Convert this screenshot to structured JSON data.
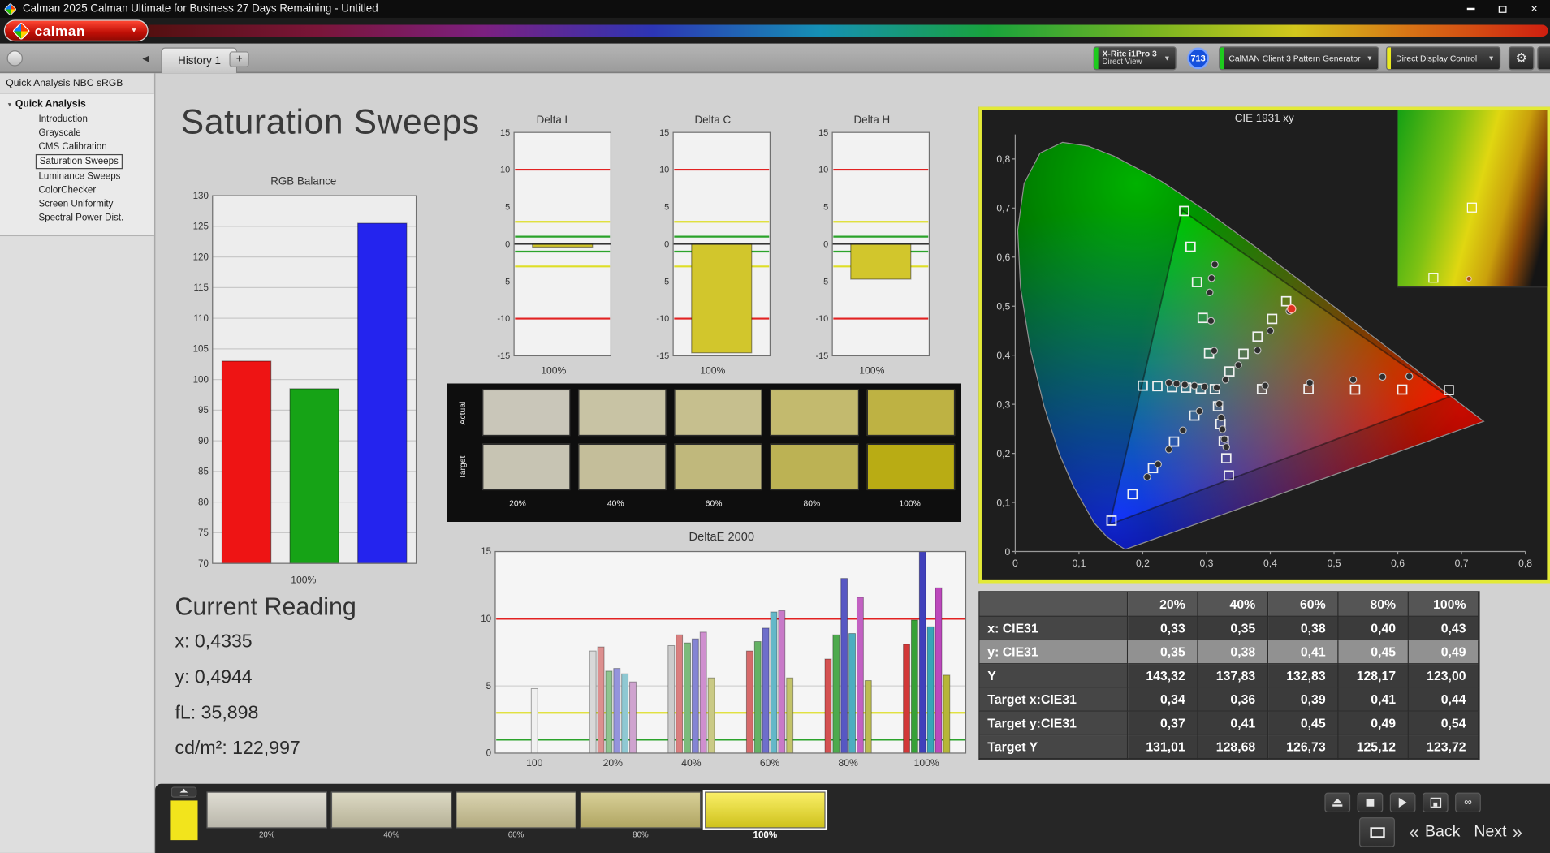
{
  "window": {
    "title": "Calman 2025 Calman Ultimate for Business 27 Days Remaining  - Untitled"
  },
  "brand": {
    "logo_text": "calman"
  },
  "tab_bar": {
    "tabs": [
      {
        "label": "History 1"
      }
    ],
    "add_tab_label": "+",
    "meter": {
      "line1": "X-Rite i1Pro 3",
      "line2": "Direct View",
      "accent": "#1ecb1e"
    },
    "meter_badge": "713",
    "source": {
      "label": "CalMAN Client 3 Pattern Generator",
      "accent": "#1ecb1e"
    },
    "display_control": {
      "label": "Direct Display Control",
      "accent": "#e9e920"
    }
  },
  "sidebar": {
    "header": "Quick Analysis NBC sRGB",
    "root_label": "Quick Analysis",
    "items": [
      {
        "label": "Introduction",
        "selected": false
      },
      {
        "label": "Grayscale",
        "selected": false
      },
      {
        "label": "CMS Calibration",
        "selected": false
      },
      {
        "label": "Saturation Sweeps",
        "selected": true
      },
      {
        "label": "Luminance Sweeps",
        "selected": false
      },
      {
        "label": "ColorChecker",
        "selected": false
      },
      {
        "label": "Screen Uniformity",
        "selected": false
      },
      {
        "label": "Spectral Power Dist.",
        "selected": false
      }
    ]
  },
  "page_title": "Saturation Sweeps",
  "current_reading": {
    "title": "Current Reading",
    "lines": [
      "x: 0,4335",
      "y: 0,4944",
      "fL: 35,898",
      "cd/m²: 122,997"
    ]
  },
  "sat_swatches": {
    "row_labels": [
      "Actual",
      "Target"
    ],
    "column_labels": [
      "20%",
      "40%",
      "60%",
      "80%",
      "100%"
    ],
    "actual_colors": [
      "#c9c6b9",
      "#c8c3a4",
      "#c6bf8e",
      "#c3ba6e",
      "#beb243"
    ],
    "target_colors": [
      "#c7c4b3",
      "#c4be9a",
      "#c0b87c",
      "#bcb254",
      "#b9ac14"
    ]
  },
  "results_table": {
    "columns": [
      "20%",
      "40%",
      "60%",
      "80%",
      "100%"
    ],
    "rows": [
      {
        "label": "x: CIE31",
        "values": [
          "0,33",
          "0,35",
          "0,38",
          "0,40",
          "0,43"
        ],
        "highlight": false
      },
      {
        "label": "y: CIE31",
        "values": [
          "0,35",
          "0,38",
          "0,41",
          "0,45",
          "0,49"
        ],
        "highlight": true
      },
      {
        "label": "Y",
        "values": [
          "143,32",
          "137,83",
          "132,83",
          "128,17",
          "123,00"
        ],
        "highlight": false
      },
      {
        "label": "Target x:CIE31",
        "values": [
          "0,34",
          "0,36",
          "0,39",
          "0,41",
          "0,44"
        ],
        "highlight": false
      },
      {
        "label": "Target y:CIE31",
        "values": [
          "0,37",
          "0,41",
          "0,45",
          "0,49",
          "0,54"
        ],
        "highlight": false
      },
      {
        "label": "Target Y",
        "values": [
          "131,01",
          "128,68",
          "126,73",
          "125,12",
          "123,72"
        ],
        "highlight": false
      }
    ]
  },
  "bottom_bar": {
    "swatches": [
      {
        "label": "20%",
        "color": "#d3d0c2",
        "selected": false
      },
      {
        "label": "40%",
        "color": "#cfcaac",
        "selected": false
      },
      {
        "label": "60%",
        "color": "#ccc392",
        "selected": false
      },
      {
        "label": "80%",
        "color": "#c9bd70",
        "selected": false
      },
      {
        "label": "100%",
        "color": "#d2c51d",
        "selected": true
      }
    ],
    "back_label": "Back",
    "next_label": "Next"
  },
  "chart_data": [
    {
      "id": "rgb_balance",
      "type": "bar",
      "title": "RGB Balance",
      "xlabel": "100%",
      "categories": [
        "Red",
        "Green",
        "Blue"
      ],
      "values": [
        103.0,
        98.5,
        125.5
      ],
      "colors": [
        "#ee1414",
        "#16a316",
        "#2424ee"
      ],
      "ylim": [
        70,
        130
      ],
      "ytick_step": 5,
      "grid": true
    },
    {
      "id": "delta_l",
      "type": "bar",
      "title": "Delta L",
      "xlabel": "100%",
      "categories": [
        "100%"
      ],
      "values": [
        -0.4
      ],
      "colors": [
        "#d2c62c"
      ],
      "ylim": [
        -15,
        15
      ],
      "ytick_step": 5,
      "grid": false,
      "ref_lines": [
        {
          "y": 10,
          "color": "#e22222"
        },
        {
          "y": -10,
          "color": "#e22222"
        },
        {
          "y": 3,
          "color": "#dede26"
        },
        {
          "y": -3,
          "color": "#dede26"
        },
        {
          "y": 1,
          "color": "#2ba32b"
        },
        {
          "y": -1,
          "color": "#2ba32b"
        }
      ]
    },
    {
      "id": "delta_c",
      "type": "bar",
      "title": "Delta C",
      "xlabel": "100%",
      "categories": [
        "100%"
      ],
      "values": [
        -14.6
      ],
      "colors": [
        "#d2c62c"
      ],
      "ylim": [
        -15,
        15
      ],
      "ytick_step": 5,
      "grid": false,
      "ref_lines": [
        {
          "y": 10,
          "color": "#e22222"
        },
        {
          "y": -10,
          "color": "#e22222"
        },
        {
          "y": 3,
          "color": "#dede26"
        },
        {
          "y": -3,
          "color": "#dede26"
        },
        {
          "y": 1,
          "color": "#2ba32b"
        },
        {
          "y": -1,
          "color": "#2ba32b"
        }
      ]
    },
    {
      "id": "delta_h",
      "type": "bar",
      "title": "Delta H",
      "xlabel": "100%",
      "categories": [
        "100%"
      ],
      "values": [
        -4.7
      ],
      "colors": [
        "#d2c62c"
      ],
      "ylim": [
        -15,
        15
      ],
      "ytick_step": 5,
      "grid": false,
      "ref_lines": [
        {
          "y": 10,
          "color": "#e22222"
        },
        {
          "y": -10,
          "color": "#e22222"
        },
        {
          "y": 3,
          "color": "#dede26"
        },
        {
          "y": -3,
          "color": "#dede26"
        },
        {
          "y": 1,
          "color": "#2ba32b"
        },
        {
          "y": -1,
          "color": "#2ba32b"
        }
      ]
    },
    {
      "id": "deltae2000",
      "type": "grouped_bar",
      "title": "DeltaE 2000",
      "ylim": [
        0,
        15
      ],
      "yticks": [
        0,
        5,
        10,
        15
      ],
      "ref_lines": [
        {
          "y": 10,
          "color": "#e22222"
        },
        {
          "y": 3,
          "color": "#dede26"
        },
        {
          "y": 1,
          "color": "#2ba32b"
        }
      ],
      "groups": [
        {
          "label": "100",
          "bars": [
            {
              "color": "#f0f0f0",
              "value": 4.8
            }
          ]
        },
        {
          "label": "20%",
          "bars": [
            {
              "color": "#d8d8d8",
              "value": 7.6
            },
            {
              "color": "#dc8f8f",
              "value": 7.9
            },
            {
              "color": "#8fc48f",
              "value": 6.1
            },
            {
              "color": "#9494dc",
              "value": 6.3
            },
            {
              "color": "#8fc8d2",
              "value": 5.9
            },
            {
              "color": "#cfa3cf",
              "value": 5.3
            }
          ]
        },
        {
          "label": "40%",
          "bars": [
            {
              "color": "#cccccc",
              "value": 8.0
            },
            {
              "color": "#d97f7f",
              "value": 8.8
            },
            {
              "color": "#7bbb7b",
              "value": 8.2
            },
            {
              "color": "#8484d4",
              "value": 8.5
            },
            {
              "color": "#cf8fcf",
              "value": 9.0
            },
            {
              "color": "#caca85",
              "value": 5.6
            }
          ]
        },
        {
          "label": "60%",
          "bars": [
            {
              "color": "#d66a6a",
              "value": 7.6
            },
            {
              "color": "#64b264",
              "value": 8.3
            },
            {
              "color": "#6e6ecb",
              "value": 9.3
            },
            {
              "color": "#64b8c8",
              "value": 10.5
            },
            {
              "color": "#c879c8",
              "value": 10.6
            },
            {
              "color": "#c3c36a",
              "value": 5.6
            }
          ]
        },
        {
          "label": "80%",
          "bars": [
            {
              "color": "#d45151",
              "value": 7.0
            },
            {
              "color": "#4daa4d",
              "value": 8.8
            },
            {
              "color": "#5757c3",
              "value": 13.0
            },
            {
              "color": "#4daec0",
              "value": 8.9
            },
            {
              "color": "#c261c2",
              "value": 11.6
            },
            {
              "color": "#bcbc51",
              "value": 5.4
            }
          ]
        },
        {
          "label": "100%",
          "bars": [
            {
              "color": "#d23838",
              "value": 8.1
            },
            {
              "color": "#37a137",
              "value": 9.9
            },
            {
              "color": "#4040bb",
              "value": 15.0
            },
            {
              "color": "#37a5b8",
              "value": 9.4
            },
            {
              "color": "#bc48bc",
              "value": 12.3
            },
            {
              "color": "#b6b638",
              "value": 5.8
            }
          ]
        }
      ]
    },
    {
      "id": "cie",
      "type": "scatter",
      "title": "CIE 1931 xy",
      "xlim": [
        0,
        0.8
      ],
      "ylim": [
        0,
        0.85
      ],
      "x_tick_labels": [
        "0",
        "0,1",
        "0,2",
        "0,3",
        "0,4",
        "0,5",
        "0,6",
        "0,7",
        "0,8"
      ],
      "y_tick_labels": [
        "0",
        "0,1",
        "0,2",
        "0,3",
        "0,4",
        "0,5",
        "0,6",
        "0,7",
        "0,8"
      ],
      "gamut_triangle": [
        [
          0.68,
          0.315
        ],
        [
          0.262,
          0.695
        ],
        [
          0.148,
          0.055
        ]
      ],
      "white_point": [
        0.313,
        0.331
      ],
      "targets": [
        [
          0.387,
          0.331
        ],
        [
          0.46,
          0.331
        ],
        [
          0.533,
          0.33
        ],
        [
          0.607,
          0.33
        ],
        [
          0.68,
          0.329
        ],
        [
          0.304,
          0.404
        ],
        [
          0.294,
          0.476
        ],
        [
          0.285,
          0.549
        ],
        [
          0.275,
          0.621
        ],
        [
          0.265,
          0.694
        ],
        [
          0.281,
          0.277
        ],
        [
          0.249,
          0.224
        ],
        [
          0.216,
          0.17
        ],
        [
          0.184,
          0.117
        ],
        [
          0.151,
          0.063
        ],
        [
          0.291,
          0.332
        ],
        [
          0.268,
          0.334
        ],
        [
          0.246,
          0.335
        ],
        [
          0.223,
          0.337
        ],
        [
          0.2,
          0.338
        ],
        [
          0.318,
          0.296
        ],
        [
          0.322,
          0.26
        ],
        [
          0.327,
          0.225
        ],
        [
          0.331,
          0.19
        ],
        [
          0.335,
          0.155
        ],
        [
          0.336,
          0.367
        ],
        [
          0.358,
          0.403
        ],
        [
          0.38,
          0.438
        ],
        [
          0.403,
          0.474
        ],
        [
          0.425,
          0.51
        ],
        [
          0.313,
          0.331
        ]
      ],
      "measurements": [
        [
          0.33,
          0.35
        ],
        [
          0.35,
          0.38
        ],
        [
          0.38,
          0.41
        ],
        [
          0.4,
          0.45
        ],
        [
          0.43,
          0.49
        ],
        [
          0.392,
          0.338
        ],
        [
          0.462,
          0.344
        ],
        [
          0.53,
          0.35
        ],
        [
          0.576,
          0.356
        ],
        [
          0.618,
          0.357
        ],
        [
          0.312,
          0.409
        ],
        [
          0.307,
          0.47
        ],
        [
          0.305,
          0.528
        ],
        [
          0.308,
          0.557
        ],
        [
          0.313,
          0.585
        ],
        [
          0.289,
          0.286
        ],
        [
          0.263,
          0.247
        ],
        [
          0.241,
          0.208
        ],
        [
          0.224,
          0.178
        ],
        [
          0.207,
          0.152
        ],
        [
          0.297,
          0.336
        ],
        [
          0.281,
          0.338
        ],
        [
          0.266,
          0.34
        ],
        [
          0.253,
          0.342
        ],
        [
          0.241,
          0.344
        ],
        [
          0.32,
          0.301
        ],
        [
          0.323,
          0.273
        ],
        [
          0.325,
          0.249
        ],
        [
          0.328,
          0.229
        ],
        [
          0.331,
          0.213
        ],
        [
          0.316,
          0.334
        ]
      ],
      "current_point": [
        0.4335,
        0.4944
      ]
    }
  ]
}
